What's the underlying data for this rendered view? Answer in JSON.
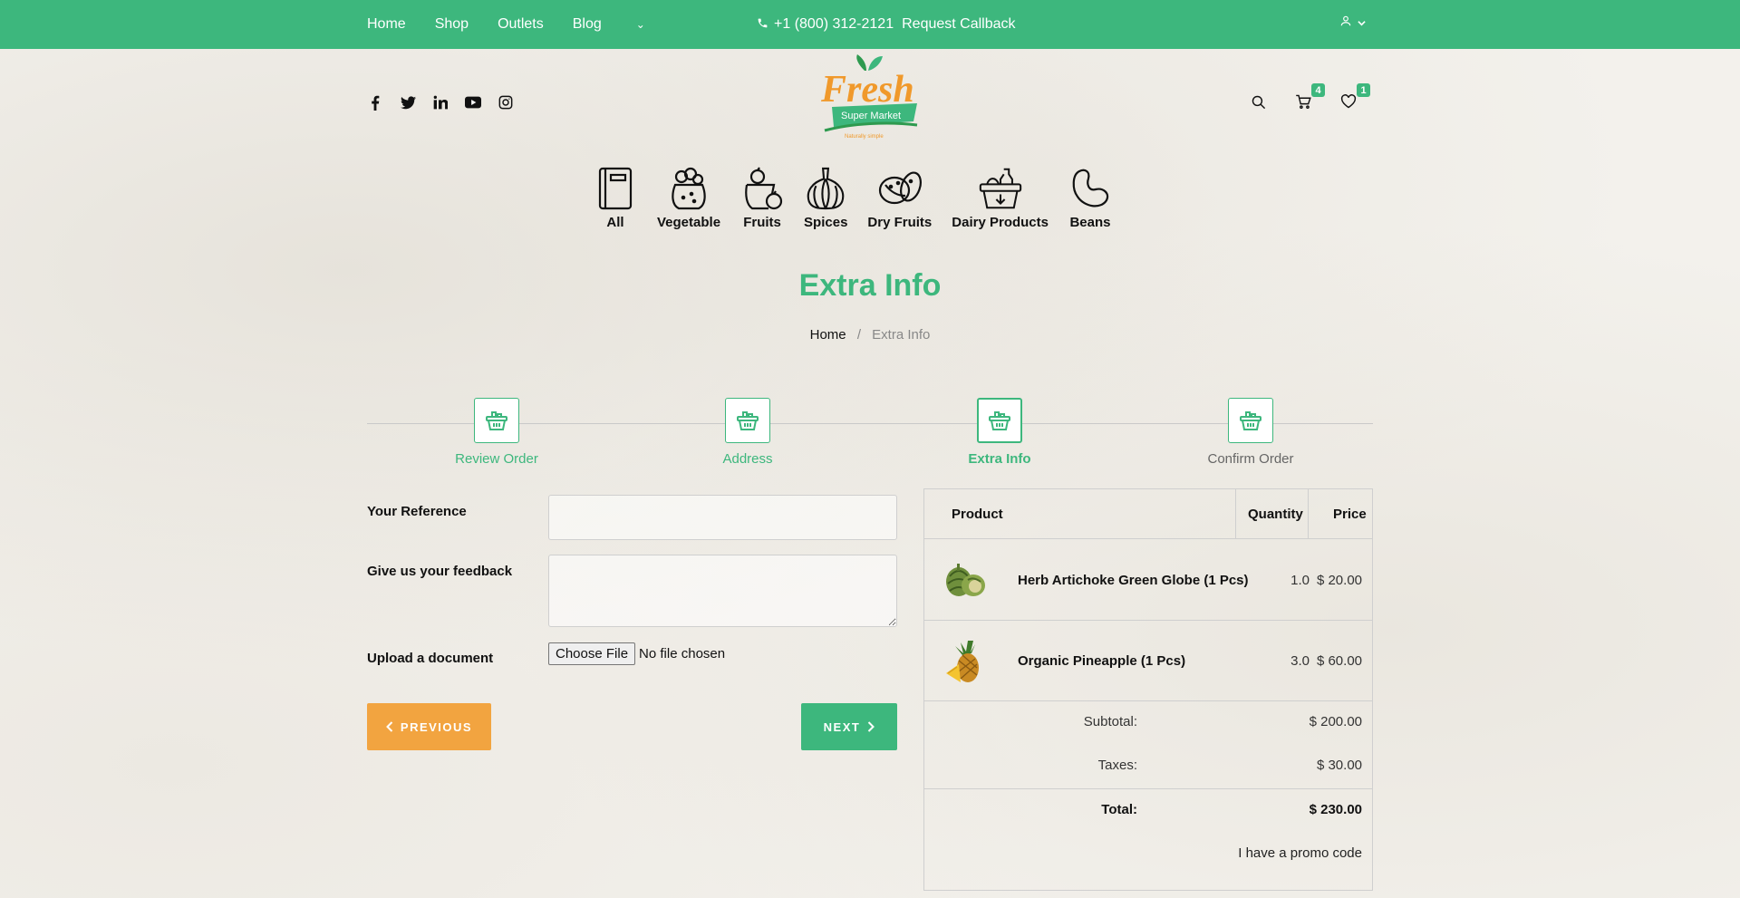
{
  "topbar": {
    "nav": [
      "Home",
      "Shop",
      "Outlets",
      "Blog"
    ],
    "more_caret": "⌄",
    "phone": "+1 (800) 312-2121",
    "callback": "Request Callback"
  },
  "header": {
    "social_icons": [
      "facebook-icon",
      "twitter-icon",
      "linkedin-icon",
      "youtube-icon",
      "instagram-icon"
    ],
    "logo": {
      "title": "Fresh",
      "subtitle": "Super Market",
      "tagline": "Naturally simple"
    },
    "cart_count": "4",
    "wishlist_count": "1"
  },
  "categories": [
    "All",
    "Vegetable",
    "Fruits",
    "Spices",
    "Dry Fruits",
    "Dairy Products",
    "Beans"
  ],
  "page": {
    "title": "Extra Info",
    "breadcrumb_home": "Home",
    "breadcrumb_sep": "/",
    "breadcrumb_current": "Extra Info"
  },
  "steps": [
    "Review Order",
    "Address",
    "Extra Info",
    "Confirm Order"
  ],
  "form": {
    "reference_label": "Your Reference",
    "reference_value": "",
    "feedback_label": "Give us your feedback",
    "feedback_value": "",
    "upload_label": "Upload a document",
    "file_button": "Choose File",
    "file_status": "No file chosen",
    "prev_label": "PREVIOUS",
    "next_label": "NEXT"
  },
  "summary": {
    "col_product": "Product",
    "col_quantity": "Quantity",
    "col_price": "Price",
    "items": [
      {
        "name": "Herb Artichoke Green Globe (1 Pcs)",
        "qty": "1.0",
        "price": "$ 20.00"
      },
      {
        "name": "Organic Pineapple (1 Pcs)",
        "qty": "3.0",
        "price": "$ 60.00"
      }
    ],
    "subtotal_label": "Subtotal:",
    "subtotal_value": "$ 200.00",
    "taxes_label": "Taxes:",
    "taxes_value": "$ 30.00",
    "total_label": "Total:",
    "total_value": "$ 230.00",
    "promo_link": "I have a promo code"
  },
  "colors": {
    "brand_green": "#3db77d",
    "accent_orange": "#f2a440",
    "logo_orange": "#f0992b"
  }
}
